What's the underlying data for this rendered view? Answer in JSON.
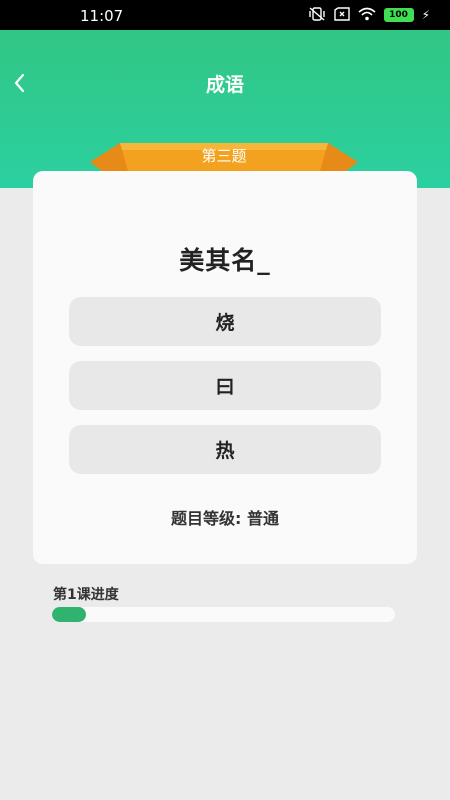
{
  "status_bar": {
    "time": "11:07",
    "icons": [
      "vibrate-off-icon",
      "sim-x-icon",
      "wifi-icon",
      "battery-icon",
      "charging-icon"
    ],
    "battery": "100"
  },
  "header": {
    "title": "成语",
    "back_icon": "chevron-left-icon"
  },
  "question": {
    "ribbon_label": "第三题",
    "text": "美其名_"
  },
  "options": [
    "烧",
    "曰",
    "热"
  ],
  "level_text": "题目等级: 普通",
  "progress": {
    "label": "第1课进度",
    "fraction": 0.1
  },
  "colors": {
    "header_green": "#33c47f",
    "ribbon_orange": "#f2a21e",
    "progress_green": "#2fb36e"
  }
}
